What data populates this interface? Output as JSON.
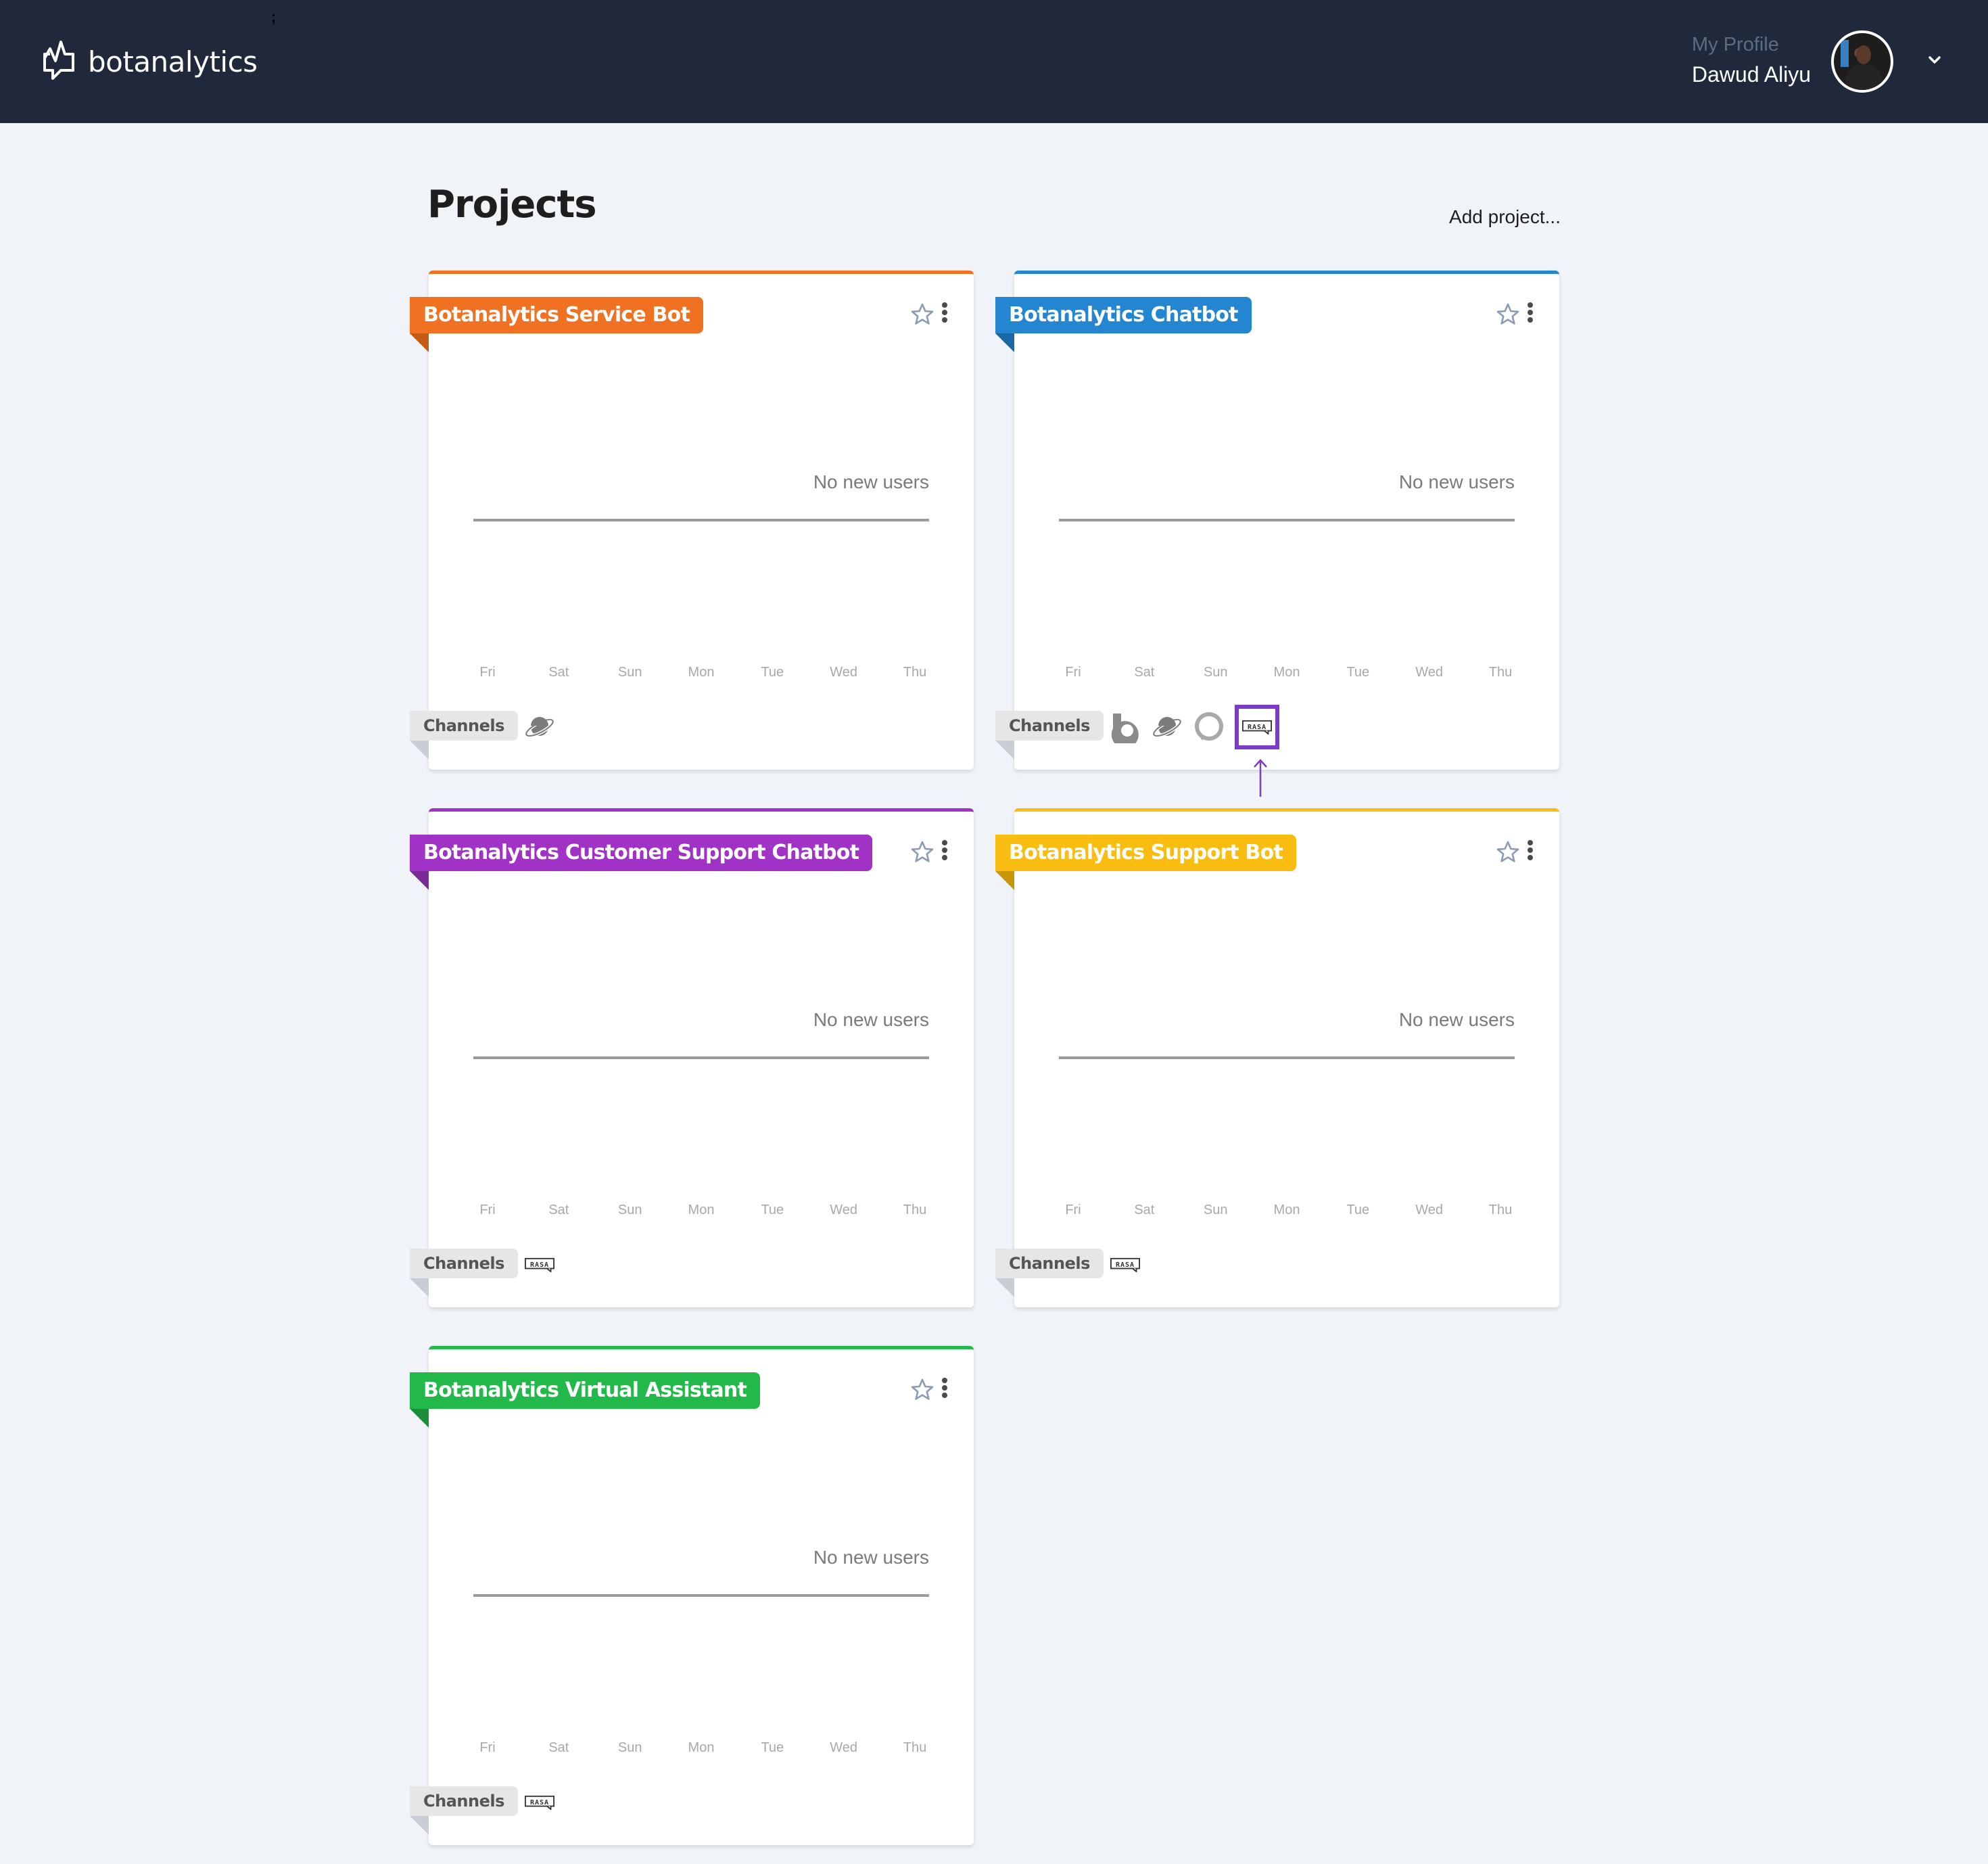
{
  "header": {
    "brand": "botanalytics",
    "stray_char": ";",
    "profile_label": "My Profile",
    "profile_name": "Dawud Aliyu",
    "icons": {
      "logo": "botanalytics-logo-icon",
      "avatar": "user-avatar",
      "dropdown": "chevron-down-icon"
    }
  },
  "main": {
    "title": "Projects",
    "add_project": "Add project...",
    "channels_label": "Channels",
    "empty_text": "No new users",
    "days": [
      "Fri",
      "Sat",
      "Sun",
      "Mon",
      "Tue",
      "Wed",
      "Thu"
    ],
    "projects": [
      {
        "name": "Botanalytics Service Bot",
        "color": "#f07122",
        "fold_color": "#c45a14",
        "channels": [
          "planet-icon"
        ]
      },
      {
        "name": "Botanalytics Chatbot",
        "color": "#2485d1",
        "fold_color": "#1b67a1",
        "channels": [
          "bixby-icon",
          "planet-icon",
          "alexa-icon",
          "rasa-icon"
        ],
        "highlighted_channel": "rasa-icon"
      },
      {
        "name": "Botanalytics Customer Support Chatbot",
        "color": "#a033c6",
        "fold_color": "#7b2a99",
        "channels": [
          "rasa-icon"
        ]
      },
      {
        "name": "Botanalytics Support Bot",
        "color": "#f9bd12",
        "fold_color": "#c99705",
        "channels": [
          "rasa-icon"
        ]
      },
      {
        "name": "Botanalytics Virtual Assistant",
        "color": "#22b84a",
        "fold_color": "#1a8e39",
        "channels": [
          "rasa-icon"
        ]
      }
    ]
  },
  "annotation": {
    "highlight_color": "#7d3bc8"
  }
}
